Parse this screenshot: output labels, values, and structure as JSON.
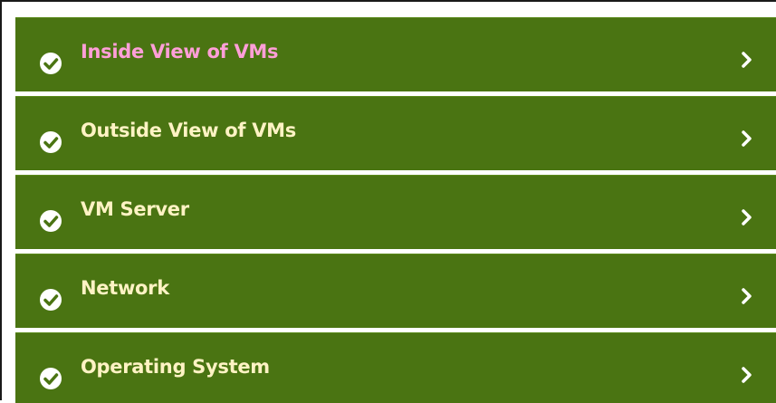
{
  "menu": {
    "items": [
      {
        "label": "Inside View of VMs",
        "icon": "check-circle-icon",
        "active": true
      },
      {
        "label": "Outside View of VMs",
        "icon": "check-circle-icon",
        "active": false
      },
      {
        "label": "VM Server",
        "icon": "check-circle-icon",
        "active": false
      },
      {
        "label": "Network",
        "icon": "check-circle-icon",
        "active": false
      },
      {
        "label": "Operating System",
        "icon": "check-circle-icon",
        "active": false
      }
    ]
  },
  "colors": {
    "item_bg": "#4a7412",
    "label_text": "#fff3c4",
    "active_label_text": "#ff9fd8",
    "icon": "#ffffff"
  }
}
